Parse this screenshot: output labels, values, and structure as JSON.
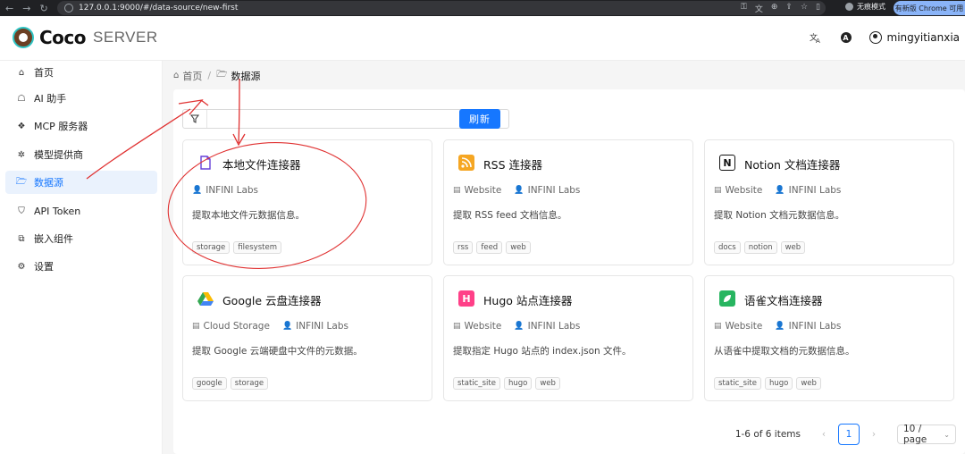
{
  "browser": {
    "url": "127.0.0.1:9000/#/data-source/new-first",
    "incognito_label": "无痕模式",
    "update_label": "有新版 Chrome 可用"
  },
  "header": {
    "brand": "Coco",
    "brand_sub": "SERVER",
    "username": "mingyitianxia"
  },
  "sidebar": {
    "items": [
      {
        "label": "首页",
        "icon": "home-icon"
      },
      {
        "label": "AI 助手",
        "icon": "robot-icon"
      },
      {
        "label": "MCP 服务器",
        "icon": "mcp-icon"
      },
      {
        "label": "模型提供商",
        "icon": "model-icon"
      },
      {
        "label": "数据源",
        "icon": "folder-icon",
        "active": true
      },
      {
        "label": "API Token",
        "icon": "shield-icon"
      },
      {
        "label": "嵌入组件",
        "icon": "embed-icon"
      },
      {
        "label": "设置",
        "icon": "gear-icon"
      }
    ]
  },
  "breadcrumb": {
    "home": "首页",
    "current": "数据源"
  },
  "toolbar": {
    "search_placeholder": "",
    "refresh_label": "刷新"
  },
  "connectors": [
    {
      "title": "本地文件连接器",
      "icon": "file-icon",
      "category": "",
      "author": "INFINI Labs",
      "desc": "提取本地文件元数据信息。",
      "tags": [
        "storage",
        "filesystem"
      ]
    },
    {
      "title": "RSS 连接器",
      "icon": "rss-icon",
      "category": "Website",
      "author": "INFINI Labs",
      "desc": "提取 RSS feed 文档信息。",
      "tags": [
        "rss",
        "feed",
        "web"
      ]
    },
    {
      "title": "Notion 文档连接器",
      "icon": "notion-icon",
      "category": "Website",
      "author": "INFINI Labs",
      "desc": "提取 Notion 文档元数据信息。",
      "tags": [
        "docs",
        "notion",
        "web"
      ]
    },
    {
      "title": "Google 云盘连接器",
      "icon": "google-drive-icon",
      "category": "Cloud Storage",
      "author": "INFINI Labs",
      "desc": "提取 Google 云端硬盘中文件的元数据。",
      "tags": [
        "google",
        "storage"
      ]
    },
    {
      "title": "Hugo 站点连接器",
      "icon": "hugo-icon",
      "category": "Website",
      "author": "INFINI Labs",
      "desc": "提取指定 Hugo 站点的 index.json 文件。",
      "tags": [
        "static_site",
        "hugo",
        "web"
      ]
    },
    {
      "title": "语雀文档连接器",
      "icon": "yuque-icon",
      "category": "Website",
      "author": "INFINI Labs",
      "desc": "从语雀中提取文档的元数据信息。",
      "tags": [
        "static_site",
        "hugo",
        "web"
      ]
    }
  ],
  "pagination": {
    "total_text": "1-6 of 6 items",
    "current_page": "1",
    "page_size": "10 / page"
  },
  "colors": {
    "primary": "#1677ff",
    "annotation": "#e03131"
  }
}
